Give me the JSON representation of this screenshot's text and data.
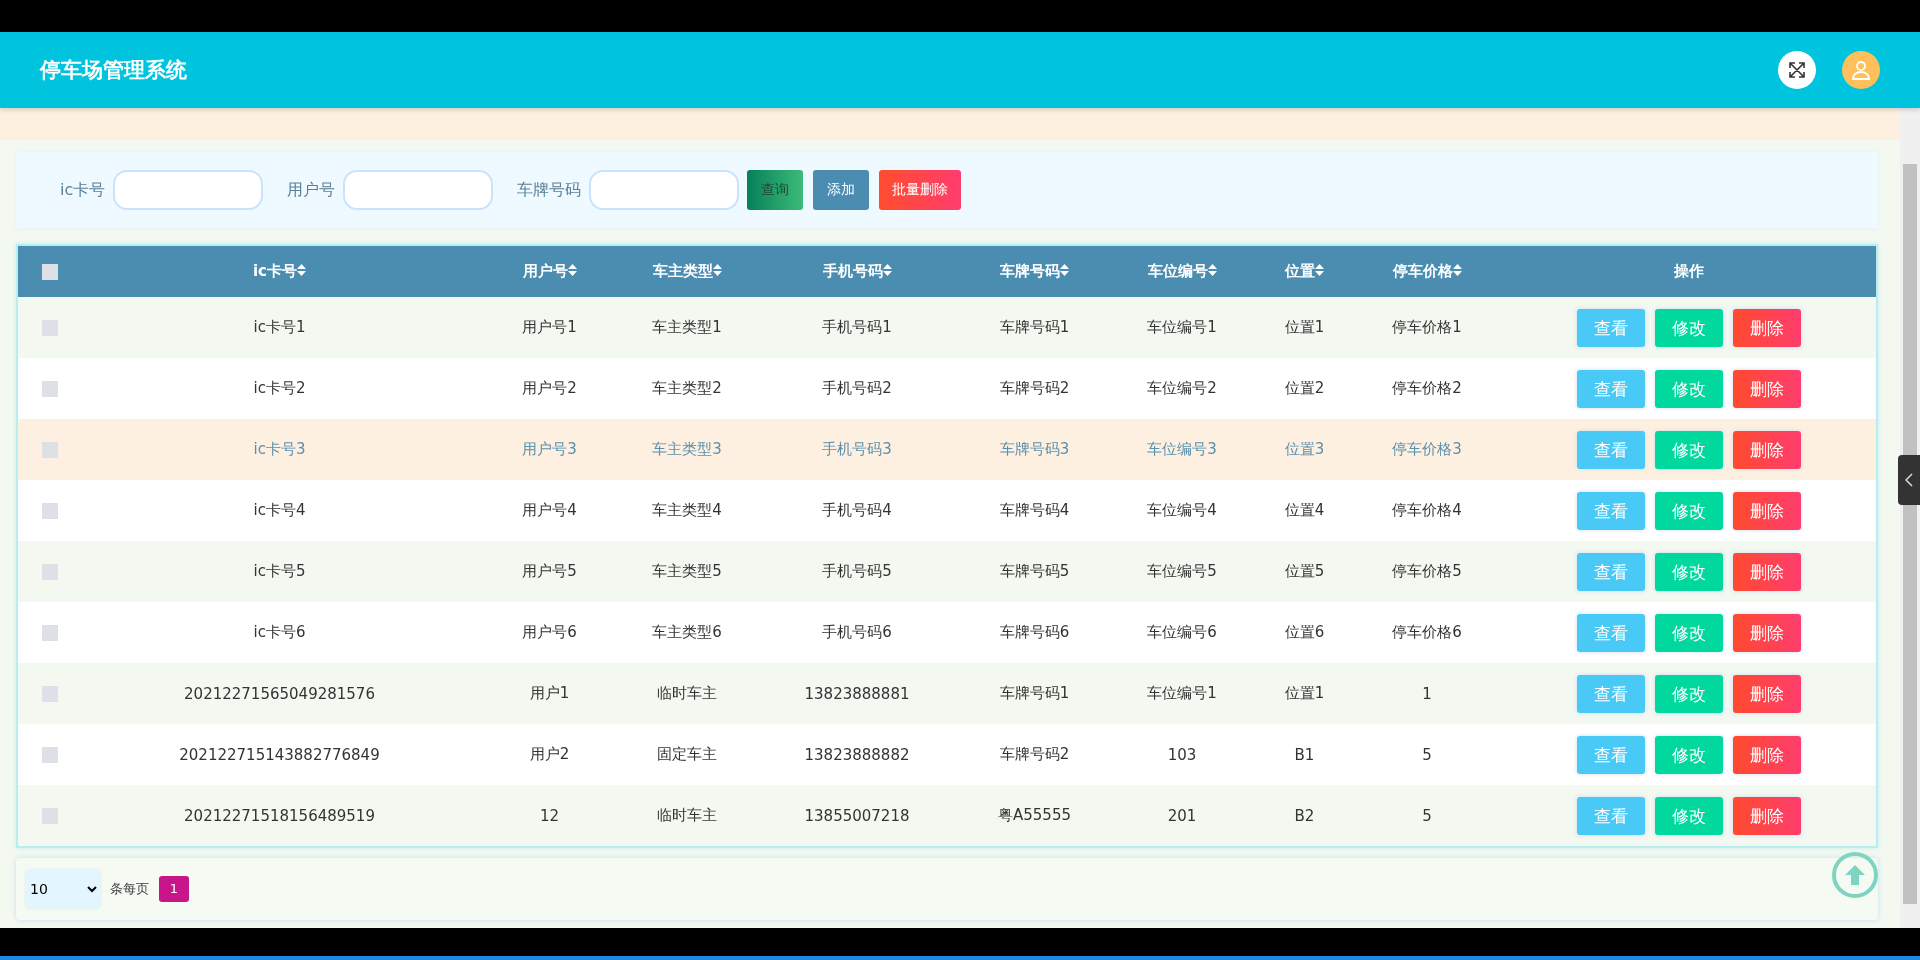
{
  "header": {
    "title": "停车场管理系统"
  },
  "search": {
    "fields": [
      {
        "label": "ic卡号"
      },
      {
        "label": "用户号"
      },
      {
        "label": "车牌号码"
      }
    ],
    "buttons": [
      {
        "label": "查询",
        "kind": "query"
      },
      {
        "label": "添加",
        "kind": "add"
      },
      {
        "label": "批量删除",
        "kind": "bulk-delete"
      }
    ]
  },
  "table": {
    "select_all": {
      "checked": false
    },
    "columns": [
      {
        "label": "ic卡号",
        "sortable": true
      },
      {
        "label": "用户号",
        "sortable": true
      },
      {
        "label": "车主类型",
        "sortable": true
      },
      {
        "label": "手机号码",
        "sortable": true
      },
      {
        "label": "车牌号码",
        "sortable": true
      },
      {
        "label": "车位编号",
        "sortable": true
      },
      {
        "label": "位置",
        "sortable": true
      },
      {
        "label": "停车价格",
        "sortable": true
      },
      {
        "label": "操作",
        "sortable": false
      }
    ],
    "rows": [
      {
        "checked": false,
        "hovered": false,
        "cells": [
          "ic卡号1",
          "用户号1",
          "车主类型1",
          "手机号码1",
          "车牌号码1",
          "车位编号1",
          "位置1",
          "停车价格1"
        ],
        "actions": [
          "查看",
          "修改",
          "删除"
        ]
      },
      {
        "checked": false,
        "hovered": false,
        "cells": [
          "ic卡号2",
          "用户号2",
          "车主类型2",
          "手机号码2",
          "车牌号码2",
          "车位编号2",
          "位置2",
          "停车价格2"
        ],
        "actions": [
          "查看",
          "修改",
          "删除"
        ]
      },
      {
        "checked": false,
        "hovered": true,
        "cells": [
          "ic卡号3",
          "用户号3",
          "车主类型3",
          "手机号码3",
          "车牌号码3",
          "车位编号3",
          "位置3",
          "停车价格3"
        ],
        "actions": [
          "查看",
          "修改",
          "删除"
        ]
      },
      {
        "checked": false,
        "hovered": false,
        "cells": [
          "ic卡号4",
          "用户号4",
          "车主类型4",
          "手机号码4",
          "车牌号码4",
          "车位编号4",
          "位置4",
          "停车价格4"
        ],
        "actions": [
          "查看",
          "修改",
          "删除"
        ]
      },
      {
        "checked": false,
        "hovered": false,
        "cells": [
          "ic卡号5",
          "用户号5",
          "车主类型5",
          "手机号码5",
          "车牌号码5",
          "车位编号5",
          "位置5",
          "停车价格5"
        ],
        "actions": [
          "查看",
          "修改",
          "删除"
        ]
      },
      {
        "checked": false,
        "hovered": false,
        "cells": [
          "ic卡号6",
          "用户号6",
          "车主类型6",
          "手机号码6",
          "车牌号码6",
          "车位编号6",
          "位置6",
          "停车价格6"
        ],
        "actions": [
          "查看",
          "修改",
          "删除"
        ]
      },
      {
        "checked": false,
        "hovered": false,
        "cells": [
          "20212271565049281576",
          "用户1",
          "临时车主",
          "13823888881",
          "车牌号码1",
          "车位编号1",
          "位置1",
          "1"
        ],
        "actions": [
          "查看",
          "修改",
          "删除"
        ]
      },
      {
        "checked": false,
        "hovered": false,
        "cells": [
          "202122715143882776849",
          "用户2",
          "固定车主",
          "13823888882",
          "车牌号码2",
          "103",
          "B1",
          "5"
        ],
        "actions": [
          "查看",
          "修改",
          "删除"
        ]
      },
      {
        "checked": false,
        "hovered": false,
        "cells": [
          "20212271518156489519",
          "12",
          "临时车主",
          "13855007218",
          "粤A55555",
          "201",
          "B2",
          "5"
        ],
        "actions": [
          "查看",
          "修改",
          "删除"
        ]
      }
    ]
  },
  "pagination": {
    "page_size": "10",
    "per_page_label": "条每页",
    "pages": [
      {
        "label": "1",
        "selected": true
      }
    ]
  }
}
